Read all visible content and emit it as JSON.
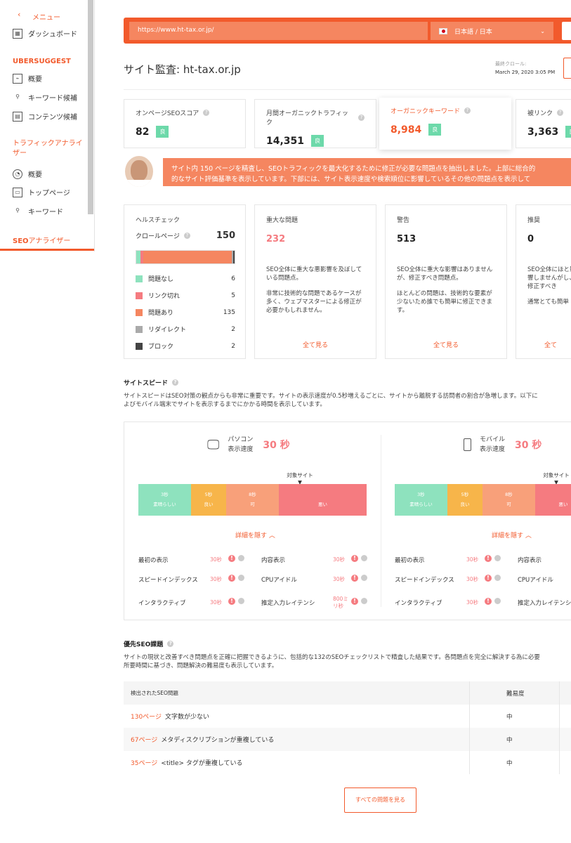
{
  "sidebar": {
    "menu_label": "メニュー",
    "dashboard": "ダッシュボード",
    "section_ubersuggest": "UBERSUGGEST",
    "ub_items": [
      "概要",
      "キーワード候補",
      "コンテンツ候補"
    ],
    "section_traffic": "トラフィックアナライザー",
    "traffic_items": [
      "概要",
      "トップページ",
      "キーワード"
    ],
    "section_seo_prefix": "SEO",
    "section_seo_suffix": "アナライザー"
  },
  "topbar": {
    "url": "https://www.ht-tax.or.jp/",
    "language": "日本語 / 日本"
  },
  "header": {
    "title": "サイト監査: ht-tax.or.jp",
    "last_crawl_label": "最終クロール:",
    "last_crawl_date": "March 29, 2020 3:05 PM"
  },
  "stats": [
    {
      "label": "オンページSEOスコア",
      "value": "82",
      "badge": "良"
    },
    {
      "label": "月間オーガニックトラフィック",
      "value": "14,351",
      "badge": "良"
    },
    {
      "label": "オーガニックキーワード",
      "value": "8,984",
      "badge": "良"
    },
    {
      "label": "被リンク",
      "value": "3,363",
      "badge": "良"
    }
  ],
  "message": {
    "line1": "サイト内 150 ページを精査し、SEOトラフィックを最大化するために修正が必要な問題点を抽出しました。上部に総合的",
    "line2": "的なサイト評価基準を表示しています。下部には、サイト表示速度や検索順位に影響しているその他の問題点を表示して"
  },
  "health": {
    "title": "ヘルスチェック",
    "crawled_label": "クロールページ",
    "crawled_value": "150",
    "rows": [
      {
        "label": "問題なし",
        "count": "6",
        "value": 6,
        "color": "#8ee2be"
      },
      {
        "label": "リンク切れ",
        "count": "5",
        "value": 5,
        "color": "#f57b80"
      },
      {
        "label": "問題あり",
        "count": "135",
        "value": 135,
        "color": "#f58660"
      },
      {
        "label": "リダイレクト",
        "count": "2",
        "value": 2,
        "color": "#aaaaaa"
      },
      {
        "label": "ブロック",
        "count": "2",
        "value": 2,
        "color": "#444444"
      }
    ]
  },
  "issues": [
    {
      "title": "重大な問題",
      "count": "232",
      "p1": "SEO全体に重大な悪影響を及ぼしている問題点。",
      "p2": "非常に技術的な問題であるケースが多く、ウェブマスターによる修正が必要かもしれません。",
      "link": "全て見る"
    },
    {
      "title": "警告",
      "count": "513",
      "p1": "SEO全体に重大な影響はありませんが、修正すべき問題点。",
      "p2": "ほとんどの問題は、技術的な要素が少ないため誰でも簡単に修正できます。",
      "link": "全て見る"
    },
    {
      "title": "推奨",
      "count": "0",
      "p1": "SEO全体にほと影響しませんがし、修正すべき",
      "p2": "通常とても簡単",
      "link": "全て"
    }
  ],
  "speed": {
    "title": "サイトスピード",
    "desc1": "サイトスピードはSEO対策の観点からも非常に重要です。サイトの表示速度が0.5秒増えるごとに、サイトから離脱する訪問者の割合が急増します。以下に",
    "desc2": "よびモバイル端末でサイトを表示するまでにかかる時間を表示しています。",
    "target_label": "対象サイト",
    "hide_details": "詳細を隠す ︿",
    "scale": [
      {
        "time": "3秒",
        "label": "素晴らしい",
        "color": "#8ee2be"
      },
      {
        "time": "5秒",
        "label": "良い",
        "color": "#f7b54a"
      },
      {
        "time": "8秒",
        "label": "可",
        "color": "#f8a07a"
      },
      {
        "time": "",
        "label": "悪い",
        "color": "#f57b80"
      }
    ],
    "desktop": {
      "name": "パソコン",
      "sub": "表示速度",
      "seconds": "30 秒",
      "metrics": [
        {
          "label": "最初の表示",
          "value": "30秒"
        },
        {
          "label": "内容表示",
          "value": "30秒"
        },
        {
          "label": "スピードインデックス",
          "value": "30秒"
        },
        {
          "label": "CPUアイドル",
          "value": "30秒"
        },
        {
          "label": "インタラクティブ",
          "value": "30秒"
        },
        {
          "label": "推定入力レイテンシ",
          "value": "800ミリ秒"
        }
      ]
    },
    "mobile": {
      "name": "モバイル",
      "sub": "表示速度",
      "seconds": "30 秒",
      "metrics": [
        {
          "label": "最初の表示",
          "value": "30秒"
        },
        {
          "label": "内容表示",
          "value": ""
        },
        {
          "label": "スピードインデックス",
          "value": "30秒"
        },
        {
          "label": "CPUアイドル",
          "value": ""
        },
        {
          "label": "インタラクティブ",
          "value": "30秒"
        },
        {
          "label": "推定入力レイテンシ",
          "value": ""
        }
      ]
    }
  },
  "priority": {
    "title": "優先SEO課題",
    "desc1": "サイトの現状と改善すべき問題点を正確に把握できるように、包括的な132のSEOチェックリストで精査した結果です。各問題点を完全に解決する為に必要",
    "desc2": "所要時間に基づき、問題解決の難易度も表示しています。",
    "col_issue": "検出されたSEO問題",
    "col_difficulty": "難易度",
    "rows": [
      {
        "pages": "130ページ",
        "issue": "文字数が少ない",
        "difficulty": "中"
      },
      {
        "pages": "67ページ",
        "issue": "メタディスクリプションが重複している",
        "difficulty": "中"
      },
      {
        "pages": "35ページ",
        "issue": "<title> タグが重複している",
        "difficulty": "中"
      }
    ],
    "all_button": "すべての問題を見る"
  }
}
